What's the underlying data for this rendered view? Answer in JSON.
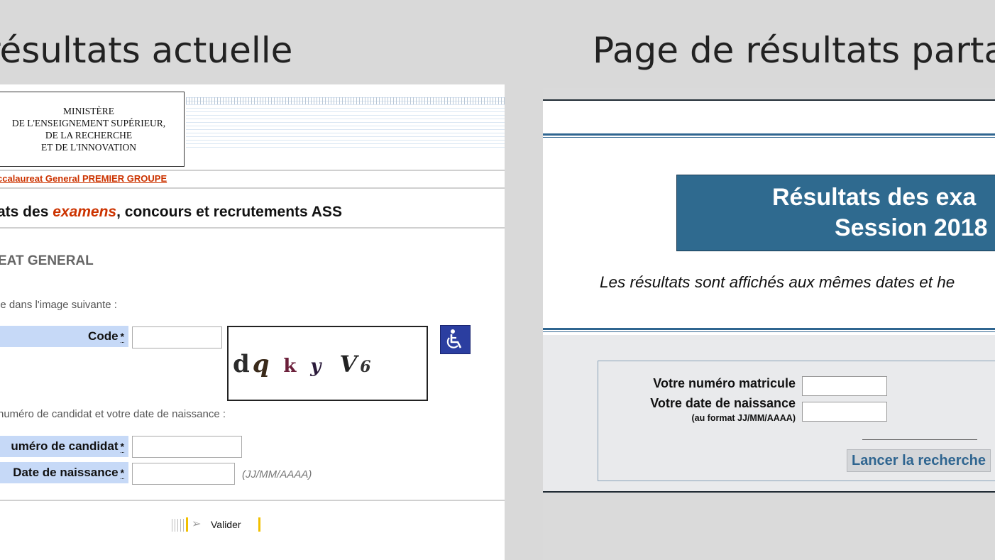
{
  "slide": {
    "title_left": "résultats actuelle",
    "title_right": "Page de résultats parta"
  },
  "current_page": {
    "ministry_lines": [
      "MINISTÈRE",
      "DE L'ENSEIGNEMENT SUPÉRIEUR,",
      "DE LA RECHERCHE",
      "ET DE L'INNOVATION"
    ],
    "breadcrumb": "ccalaureat General PREMIER GROUPE",
    "heading_pre": "ats des ",
    "heading_em": "examens",
    "heading_post": ", concours et recrutements ASS",
    "section_title": "EAT GENERAL",
    "instruction_captcha": "le dans l'image suivante :",
    "code_label": "Code",
    "required_mark": "*",
    "code_value": "",
    "captcha_chars": [
      "d",
      "q",
      "k",
      "y",
      "V",
      "6"
    ],
    "accessibility_icon": "wheelchair-icon",
    "instruction_candidate": "numéro de candidat et votre date de naissance :",
    "candidate_label": "uméro de candidat",
    "candidate_value": "",
    "birthdate_label": "Date de naissance",
    "birthdate_value": "",
    "date_hint": "(JJ/MM/AAAA)",
    "validate_label": "Valider"
  },
  "partner_page": {
    "title_line1": "Résultats des exa",
    "title_line2": "Session 2018",
    "info_text": "Les résultats sont affichés aux mêmes dates et he",
    "matricule_label": "Votre numéro matricule",
    "matricule_value": "",
    "birthdate_label": "Votre date de naissance",
    "birthdate_format": "(au format JJ/MM/AAAA)",
    "birthdate_value": "",
    "search_button": "Lancer la recherche"
  },
  "colors": {
    "accent_orange": "#cc3300",
    "label_blue": "#c6d9f7",
    "partner_blue": "#2f6a8f",
    "accessibility_blue": "#2b3ea0",
    "validate_yellow": "#f2c000"
  }
}
